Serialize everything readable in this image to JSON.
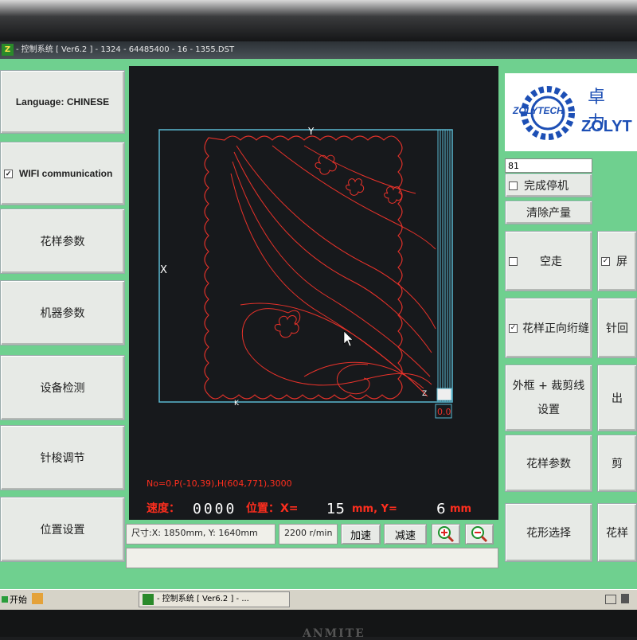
{
  "window": {
    "app_icon": "Z",
    "title": "- 控制系统 [ Ver6.2 ] - 1324 - 64485400 - 16 - 1355.DST"
  },
  "left_menu": [
    {
      "label": "Language: CHINESE"
    },
    {
      "label": "WIFI communication",
      "checked": true,
      "check_mark": "✓"
    },
    {
      "label": "花样参数"
    },
    {
      "label": "机器参数"
    },
    {
      "label": "设备检测"
    },
    {
      "label": "针梭调节"
    },
    {
      "label": "位置设置"
    }
  ],
  "canvas": {
    "axis_y": "Y",
    "axis_x": "X",
    "corner_k": "K",
    "corner_z": "Z",
    "side_value": "0.0",
    "info_line": "No=0.P(-10,39),H(604,771),3000",
    "speed_label": "速度：",
    "speed_value": "0000",
    "position_label": "位置：",
    "x_label": "X=",
    "x_value": "15",
    "x_unit": "mm, Y=",
    "y_value": "6",
    "y_unit": "mm",
    "colors": {
      "pattern": "#e8322a",
      "frame": "#5ab8d0",
      "text_red": "#ff2e1e"
    }
  },
  "status": {
    "size_text": "尺寸:X: 1850mm, Y: 1640mm",
    "speed_text": "2200 r/min",
    "accelerate": "加速",
    "decelerate": "减速",
    "zoom_in_icon": "zoom-in-icon",
    "zoom_out_icon": "zoom-out-icon"
  },
  "logo": {
    "brand_en": "ZOLYTECH",
    "brand_cn": "卓 力",
    "brand_short": "ZOLYT"
  },
  "right_panel": {
    "counter_value": "81",
    "stop_on_finish": "完成停机",
    "clear_output": "清除产量",
    "idle_run": "空走",
    "screen": "屏",
    "pattern_forward": "花样正向绗缝",
    "needle_back": "针回",
    "outer_frame_line1": "外框 + 裁剪线",
    "outer_frame_line2": "设置",
    "out": "出",
    "pattern_params": "花样参数",
    "cut": "剪",
    "shape_select": "花形选择",
    "pattern_short": "花样"
  },
  "taskbar": {
    "start": "开始",
    "task_title": "- 控制系统 [ Ver6.2 ] - ..."
  },
  "monitor": {
    "brand": "ANMITE"
  }
}
